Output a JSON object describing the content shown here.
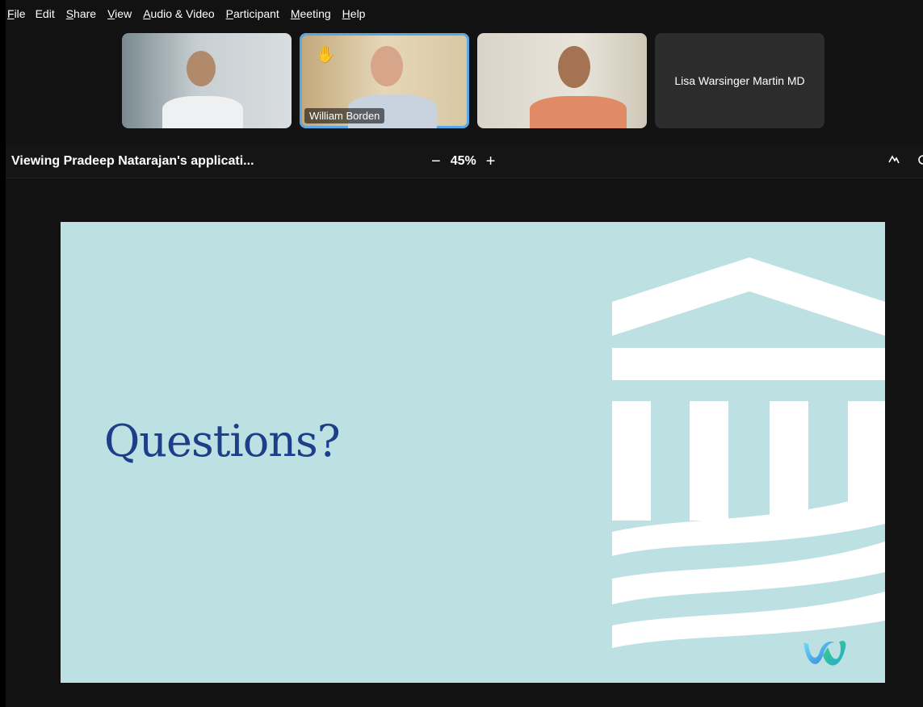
{
  "menu": {
    "items": [
      {
        "label": "File",
        "mnemonic": "F",
        "rest": "ile"
      },
      {
        "label": "Edit",
        "mnemonic": "",
        "rest": "Edit"
      },
      {
        "label": "Share",
        "mnemonic": "S",
        "rest": "hare"
      },
      {
        "label": "View",
        "mnemonic": "V",
        "rest": "iew"
      },
      {
        "label": "Audio & Video",
        "mnemonic": "A",
        "rest": "udio & Video"
      },
      {
        "label": "Participant",
        "mnemonic": "P",
        "rest": "articipant"
      },
      {
        "label": "Meeting",
        "mnemonic": "M",
        "rest": "eeting"
      },
      {
        "label": "Help",
        "mnemonic": "H",
        "rest": "elp"
      }
    ]
  },
  "participants": [
    {
      "name": "",
      "video": true
    },
    {
      "name": "William Borden",
      "video": true,
      "hand_raised": true,
      "hand_icon": "raised-hand-icon"
    },
    {
      "name": "",
      "video": true
    },
    {
      "name": "Lisa Warsinger Martin MD",
      "video": false
    }
  ],
  "share_bar": {
    "viewing": "Viewing Pradeep Natarajan's applicati...",
    "zoom_out": "−",
    "zoom_level": "45%",
    "zoom_in": "+",
    "annotate_icon": "annotate-icon"
  },
  "slide": {
    "title": "Questions?",
    "colors": {
      "background": "#bde0e3",
      "title": "#1d3f8a",
      "logo": "#ffffff"
    }
  },
  "webex_logo": "webex-logo-icon"
}
